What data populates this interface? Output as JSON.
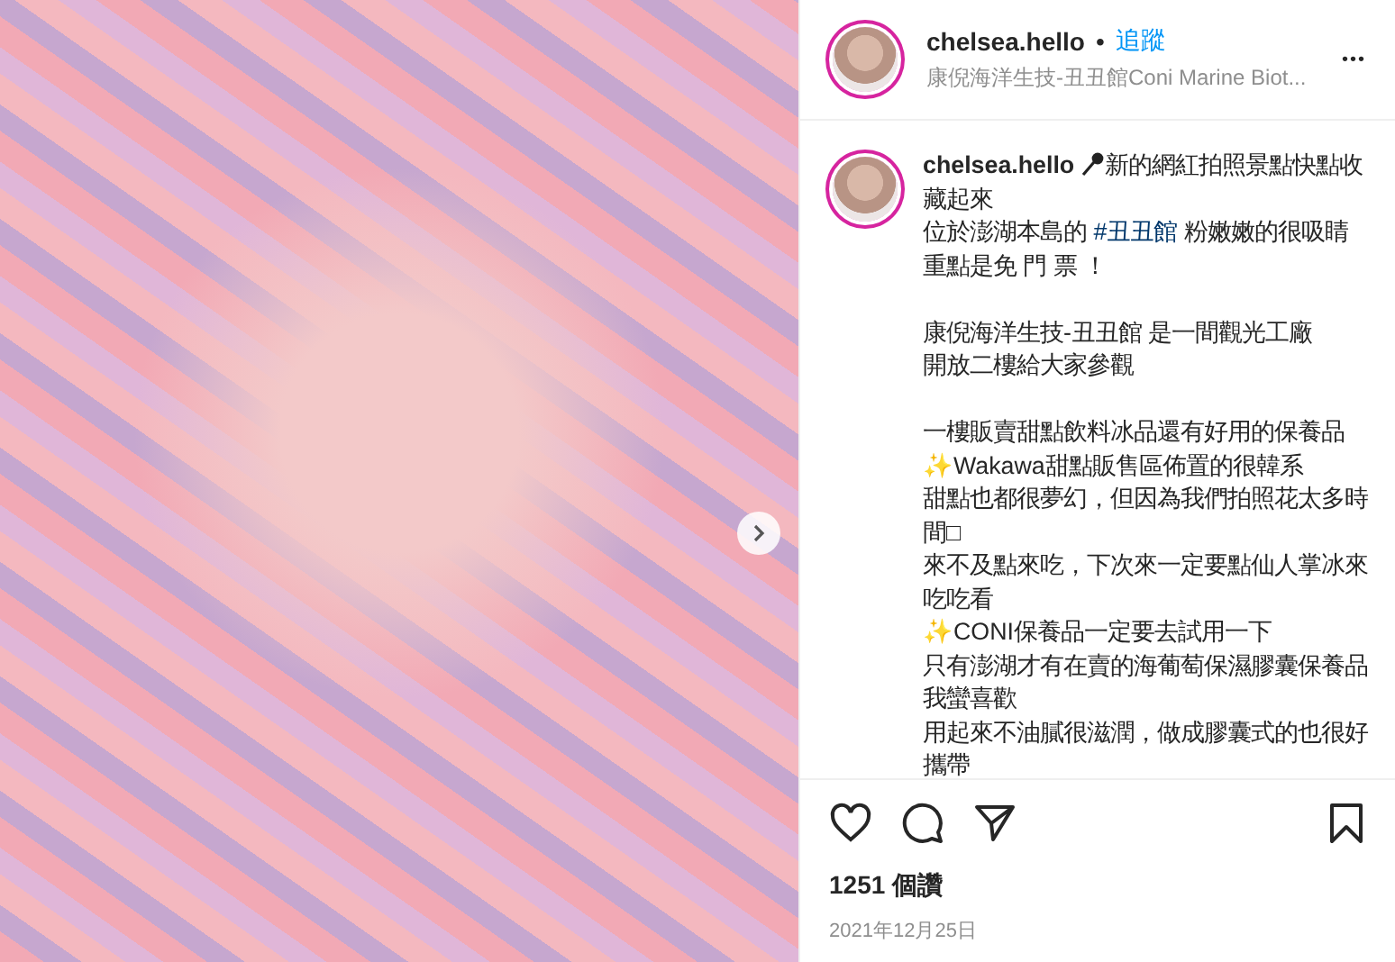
{
  "header": {
    "username": "chelsea.hello",
    "separator": "•",
    "follow": "追蹤",
    "location": "康倪海洋生技-丑丑館Coni Marine Biot...",
    "more": "•••"
  },
  "caption": {
    "username": "chelsea.hello",
    "paragraphs": [
      [
        [
          {
            "kind": "text",
            "text": "新的網紅拍照景點快點收藏起來"
          }
        ],
        [
          {
            "kind": "text",
            "text": "位於澎湖本島的 "
          },
          {
            "kind": "hashtag",
            "text": "#丑丑館"
          },
          {
            "kind": "text",
            "text": " 粉嫩嫩的很吸睛"
          }
        ],
        [
          {
            "kind": "text",
            "text": "重點是免 門 票 ！"
          }
        ]
      ],
      [
        [
          {
            "kind": "text",
            "text": "康倪海洋生技-丑丑館 是一間觀光工廠"
          }
        ],
        [
          {
            "kind": "text",
            "text": "開放二樓給大家參觀"
          }
        ]
      ],
      [
        [
          {
            "kind": "text",
            "text": "一樓販賣甜點飲料冰品還有好用的保養品"
          }
        ],
        [
          {
            "kind": "text",
            "text": "✨Wakawa甜點販售區佈置的很韓系"
          }
        ],
        [
          {
            "kind": "text",
            "text": "甜點也都很夢幻，但因為我們拍照花太多時間□"
          }
        ],
        [
          {
            "kind": "text",
            "text": "來不及點來吃，下次來一定要點仙人掌冰來吃吃看"
          }
        ],
        [
          {
            "kind": "text",
            "text": "✨CONI保養品一定要去試用一下"
          }
        ],
        [
          {
            "kind": "text",
            "text": "只有澎湖才有在賣的海葡萄保濕膠囊保養品我蠻喜歡"
          }
        ],
        [
          {
            "kind": "text",
            "text": "用起來不油膩很滋潤，做成膠囊式的也很好攜帶"
          }
        ]
      ]
    ]
  },
  "likes": "1251 個讚",
  "date": "2021年12月25日"
}
